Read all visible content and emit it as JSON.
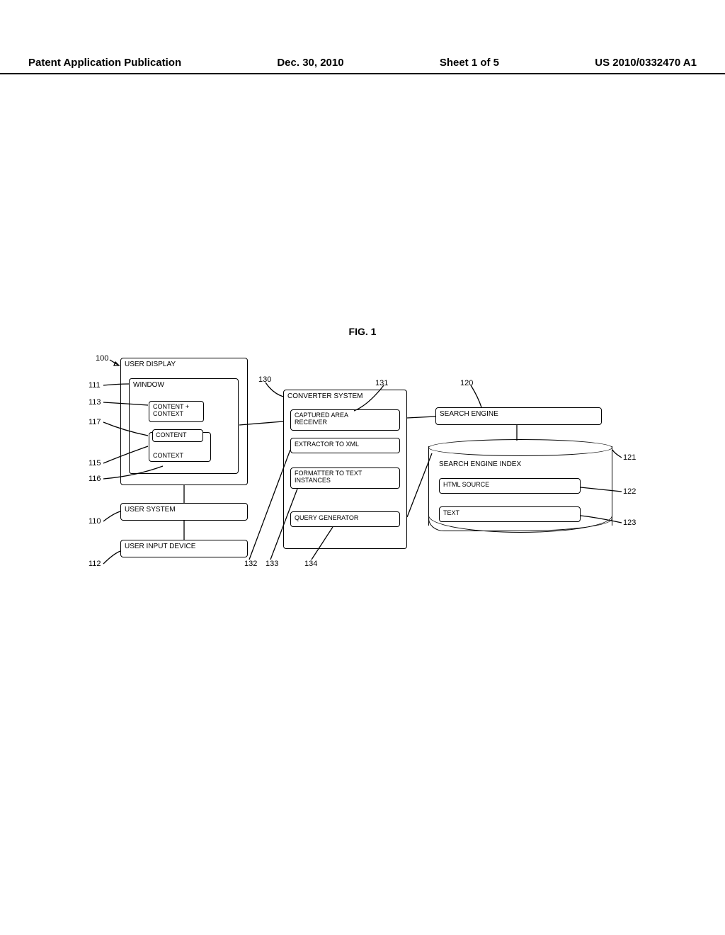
{
  "header": {
    "pub_type": "Patent Application Publication",
    "date": "Dec. 30, 2010",
    "sheet": "Sheet 1 of 5",
    "pub_number": "US 2010/0332470 A1"
  },
  "figure_title": "FIG. 1",
  "blocks": {
    "user_display": "USER DISPLAY",
    "window": "WINDOW",
    "content_context_1": "CONTENT +\nCONTEXT",
    "content_label": "CONTENT",
    "context_label": "CONTEXT",
    "user_system": "USER SYSTEM",
    "user_input_device": "USER INPUT DEVICE",
    "converter_system": "CONVERTER SYSTEM",
    "captured_area_receiver": "CAPTURED AREA\nRECEIVER",
    "extractor_to_xml": "EXTRACTOR TO XML",
    "formatter_text_instances": "FORMATTER TO TEXT\nINSTANCES",
    "query_generator": "QUERY GENERATOR",
    "search_engine": "SEARCH  ENGINE",
    "search_engine_index": "SEARCH ENGINE INDEX",
    "html_source": "HTML SOURCE",
    "text": "TEXT"
  },
  "refs": {
    "r100": "100",
    "r111": "111",
    "r113": "113",
    "r117": "117",
    "r115": "115",
    "r116": "116",
    "r110": "110",
    "r112": "112",
    "r130": "130",
    "r131": "131",
    "r132": "132",
    "r133": "133",
    "r134": "134",
    "r120": "120",
    "r121": "121",
    "r122": "122",
    "r123": "123"
  }
}
